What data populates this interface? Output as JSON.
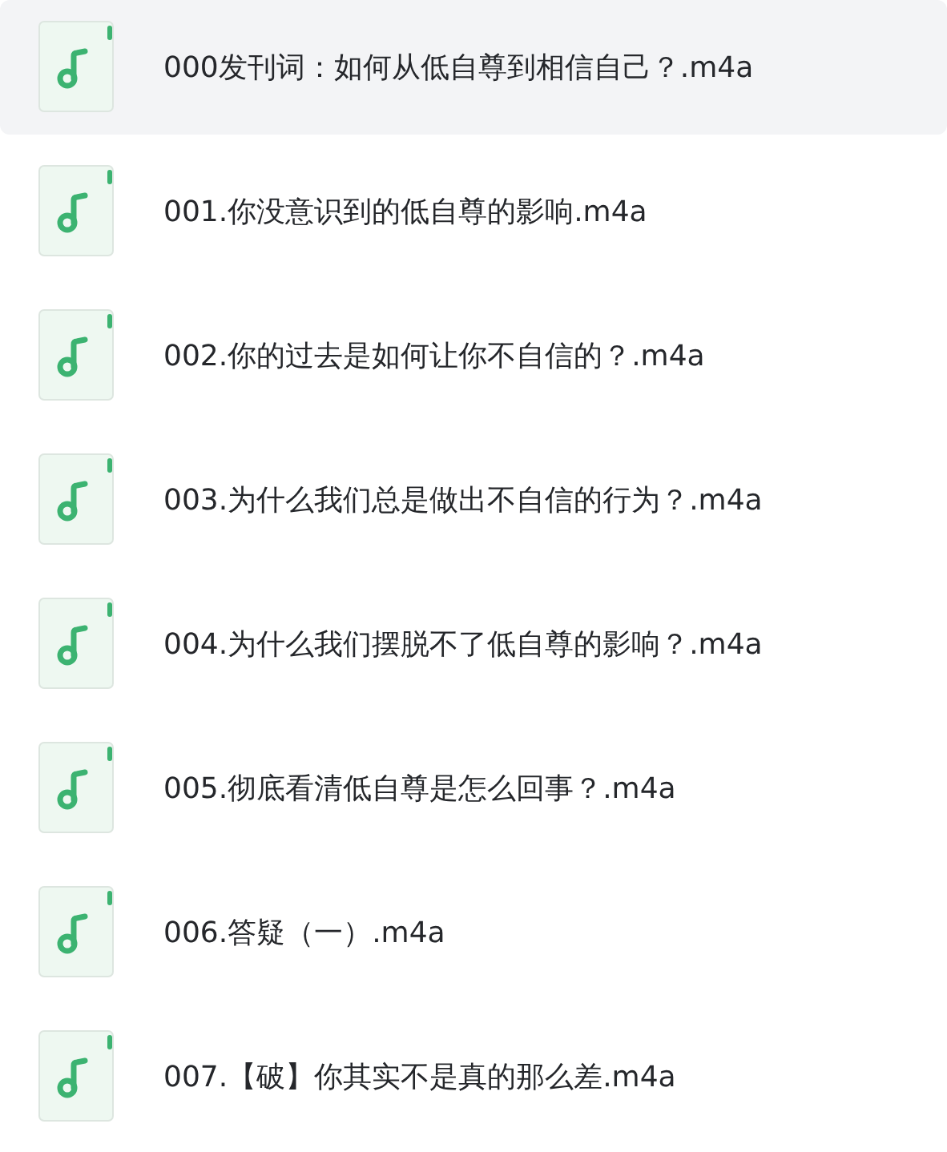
{
  "files": [
    {
      "name": "000发刊词：如何从低自尊到相信自己？.m4a",
      "selected": true
    },
    {
      "name": "001.你没意识到的低自尊的影响.m4a",
      "selected": false
    },
    {
      "name": "002.你的过去是如何让你不自信的？.m4a",
      "selected": false
    },
    {
      "name": "003.为什么我们总是做出不自信的行为？.m4a",
      "selected": false
    },
    {
      "name": "004.为什么我们摆脱不了低自尊的影响？.m4a",
      "selected": false
    },
    {
      "name": "005.彻底看清低自尊是怎么回事？.m4a",
      "selected": false
    },
    {
      "name": "006.答疑（一）.m4a",
      "selected": false
    },
    {
      "name": "007.【破】你其实不是真的那么差.m4a",
      "selected": false
    }
  ]
}
